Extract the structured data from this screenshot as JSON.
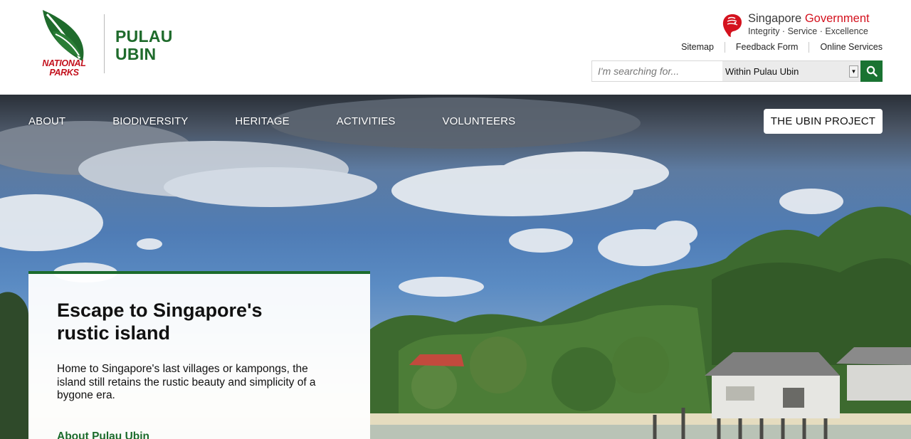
{
  "brand": {
    "agency_name_line1": "NATIONAL",
    "agency_name_line2": "PARKS",
    "site_name_line1": "PULAU",
    "site_name_line2": "UBIN",
    "leaf_color": "#1f6b2c",
    "agency_text_color": "#c3121e"
  },
  "government": {
    "title_main": "Singapore ",
    "title_accent": "Government",
    "tagline": "Integrity · Service · Excellence",
    "icon": "lion-head-icon",
    "accent_color": "#d4121e"
  },
  "utility_links": [
    {
      "label": "Sitemap"
    },
    {
      "label": "Feedback Form"
    },
    {
      "label": "Online Services"
    }
  ],
  "search": {
    "placeholder": "I'm searching for...",
    "value": "",
    "scope_selected": "Within Pulau Ubin",
    "button_icon": "search-icon",
    "button_color": "#1a7332"
  },
  "nav": {
    "items": [
      {
        "label": "ABOUT"
      },
      {
        "label": "BIODIVERSITY"
      },
      {
        "label": "HERITAGE"
      },
      {
        "label": "ACTIVITIES"
      },
      {
        "label": "VOLUNTEERS"
      }
    ],
    "project_button": "THE UBIN PROJECT"
  },
  "hero": {
    "title": "Escape to Singapore's rustic island",
    "description": "Home to Singapore's last villages or kampongs, the island still retains the rustic beauty and simplicity of a bygone era.",
    "link": "About Pulau Ubin",
    "accent_color": "#1b6b2c"
  }
}
